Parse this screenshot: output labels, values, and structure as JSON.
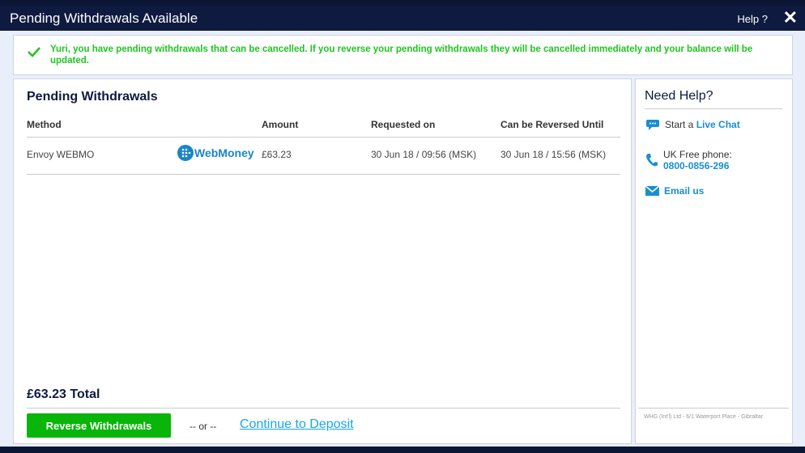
{
  "header": {
    "title": "Pending Withdrawals Available",
    "help": "Help ?",
    "close": "✕"
  },
  "alert": {
    "message": "Yuri, you have pending withdrawals that can be cancelled. If you reverse your pending withdrawals they will be cancelled immediately and your balance will be updated."
  },
  "main": {
    "title": "Pending Withdrawals",
    "columns": [
      "Method",
      "Amount",
      "Requested on",
      "Can be Reversed Until"
    ],
    "rows": [
      {
        "method": "Envoy WEBMO",
        "logo": "WebMoney",
        "amount": "£63.23",
        "requested": "30 Jun 18 / 09:56 (MSK)",
        "until": "30 Jun 18 / 15:56 (MSK)"
      }
    ],
    "total": "£63.23 Total",
    "reverse_button": "Reverse Withdrawals",
    "or": "-- or --",
    "continue_link": "Continue to Deposit"
  },
  "side": {
    "title": "Need Help?",
    "chat_prefix": "Start a",
    "chat_link": "Live Chat",
    "phone_label": "UK Free phone:",
    "phone": "0800-0856-296",
    "email": "Email us",
    "footer": "WHG (Int'l) Ltd - 6/1 Waterport Place - Gibraltar"
  }
}
